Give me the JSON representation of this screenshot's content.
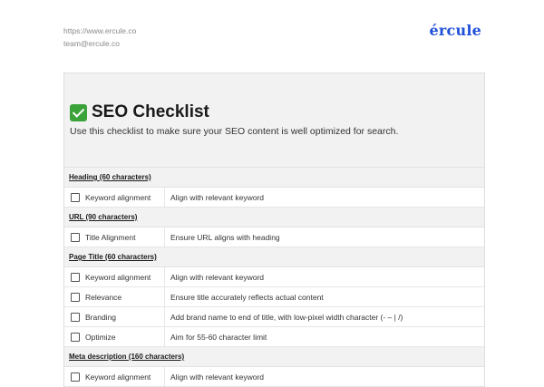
{
  "header": {
    "website": "https://www.ercule.co",
    "email": "team@ercule.co",
    "logo": "ércule"
  },
  "hero": {
    "title": "SEO Checklist",
    "subtitle": "Use this checklist to make sure your SEO content is well optimized for search.",
    "icon": "white-check-mark-icon",
    "icon_color": "#3ca33a"
  },
  "sections": [
    {
      "title": "Heading (60 characters)",
      "items": [
        {
          "label": "Keyword alignment",
          "desc": "Align with relevant keyword",
          "checked": false
        }
      ]
    },
    {
      "title": "URL (90 characters)",
      "items": [
        {
          "label": "Title Alignment",
          "desc": "Ensure URL aligns with heading",
          "checked": false
        }
      ]
    },
    {
      "title": "Page Title (60 characters)",
      "items": [
        {
          "label": "Keyword alignment",
          "desc": "Align with relevant keyword",
          "checked": false
        },
        {
          "label": "Relevance",
          "desc": "Ensure title accurately reflects actual content",
          "checked": false
        },
        {
          "label": "Branding",
          "desc": "Add brand name to end of title, with low-pixel width character (- – | /)",
          "checked": false
        },
        {
          "label": "Optimize",
          "desc": "Aim for 55-60 character limit",
          "checked": false
        }
      ]
    },
    {
      "title": "Meta description (160 characters)",
      "items": [
        {
          "label": "Keyword alignment",
          "desc": "Align with relevant keyword",
          "checked": false
        }
      ]
    }
  ],
  "colors": {
    "logo": "#1f4fd8",
    "section_bg": "#f2f2f2"
  }
}
